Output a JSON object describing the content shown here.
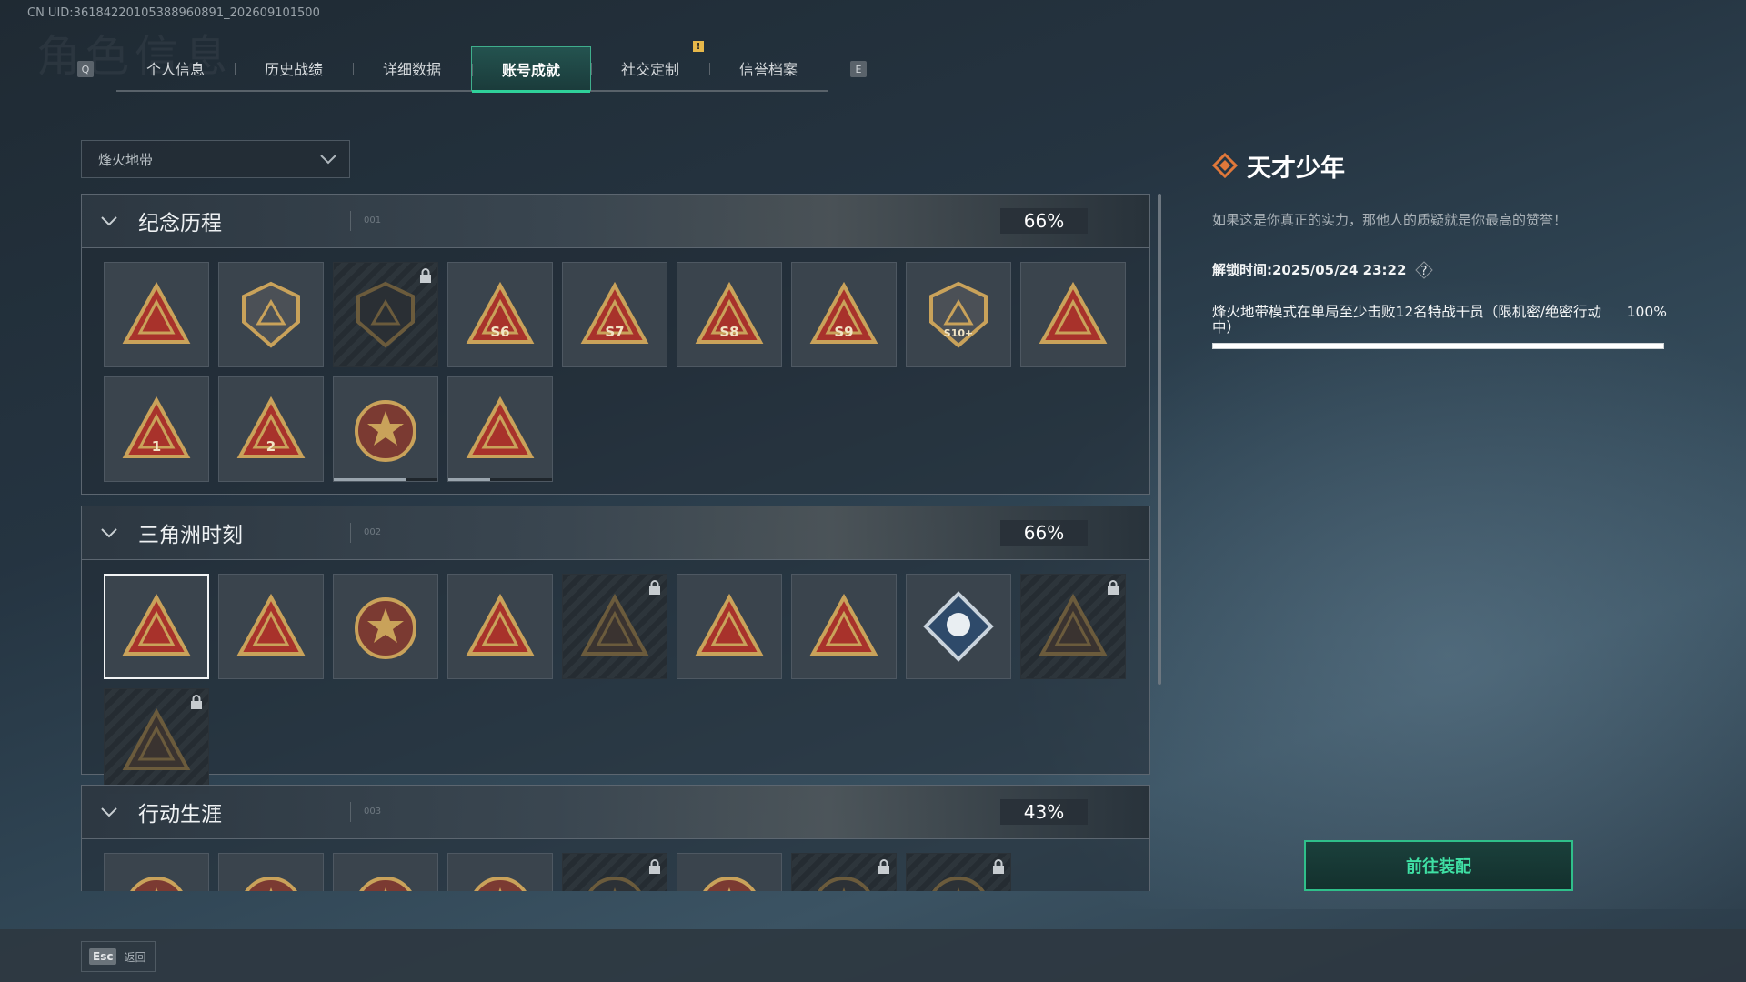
{
  "uid": "CN UID:36184220105388960891_202609101500",
  "tabs": {
    "left_key": "Q",
    "right_key": "E",
    "items": [
      {
        "label": "个人信息"
      },
      {
        "label": "历史战绩"
      },
      {
        "label": "详细数据"
      },
      {
        "label": "账号成就"
      },
      {
        "label": "社交定制"
      },
      {
        "label": "信誉档案"
      }
    ],
    "active_index": 3,
    "notification_badge": "!"
  },
  "mode_dropdown": {
    "selected": "烽火地带"
  },
  "sections": [
    {
      "title": "纪念历程",
      "number": "001",
      "percent": "66%",
      "tiles": [
        {
          "icon": "triangle-emblem-icon",
          "locked": false
        },
        {
          "icon": "helicopter-shield-icon",
          "locked": false
        },
        {
          "icon": "dark-shield-emblem-icon",
          "locked": true
        },
        {
          "icon": "s6-triangle-badge-icon",
          "locked": false,
          "text": "S6"
        },
        {
          "icon": "s7-triangle-badge-icon",
          "locked": false,
          "text": "S7"
        },
        {
          "icon": "s8-triangle-badge-icon",
          "locked": false,
          "text": "S8"
        },
        {
          "icon": "s9-triangle-badge-icon",
          "locked": false,
          "text": "S9"
        },
        {
          "icon": "s10-emblem-icon",
          "locked": false,
          "text": "S10+"
        },
        {
          "icon": "bird-triangle-badge-icon",
          "locked": false
        },
        {
          "icon": "number-1-triangle-icon",
          "locked": false,
          "text": "1"
        },
        {
          "icon": "number-2-triangle-icon",
          "locked": false,
          "text": "2"
        },
        {
          "icon": "delta-force-round-badge-icon",
          "locked": false,
          "progress": 0.7
        },
        {
          "icon": "delta-force-2026-badge-icon",
          "locked": false,
          "progress": 0.4
        }
      ]
    },
    {
      "title": "三角洲时刻",
      "number": "002",
      "percent": "66%",
      "tiles": [
        {
          "icon": "crate-triangle-badge-icon",
          "locked": false,
          "selected": true
        },
        {
          "icon": "kneeling-soldier-badge-icon",
          "locked": false
        },
        {
          "icon": "sheriff-star-badge-icon",
          "locked": false
        },
        {
          "icon": "squad-triangle-badge-icon",
          "locked": false
        },
        {
          "icon": "squad-dark-badge-icon",
          "locked": true
        },
        {
          "icon": "rocket-triangle-badge-icon",
          "locked": false
        },
        {
          "icon": "fish-triangle-badge-icon",
          "locked": false
        },
        {
          "icon": "rose-diamond-badge-icon",
          "locked": false
        },
        {
          "icon": "skull-dark-badge-icon",
          "locked": true
        },
        {
          "icon": "skull-triangle-dark-badge-icon",
          "locked": true
        }
      ]
    },
    {
      "title": "行动生涯",
      "number": "003",
      "percent": "43%",
      "tiles": [
        {
          "icon": "red-star-badge-icon",
          "locked": false
        },
        {
          "icon": "green-star-badge-icon",
          "locked": false
        },
        {
          "icon": "three-star-crest-icon",
          "locked": false
        },
        {
          "icon": "blue-star-crest-icon",
          "locked": false
        },
        {
          "icon": "dark-round-badge-icon",
          "locked": true
        },
        {
          "icon": "round-badge-icon",
          "locked": false
        },
        {
          "icon": "dark-round-badge-icon",
          "locked": true
        },
        {
          "icon": "dark-round-badge-icon",
          "locked": true
        }
      ]
    }
  ],
  "detail": {
    "title": "天才少年",
    "description": "如果这是你真正的实力，那他人的质疑就是你最高的赞誉！",
    "unlock_label": "解锁时间: ",
    "unlock_time": "2025/05/24 23:22",
    "task_text": "烽火地带模式在单局至少击败12名特战干员（限机密/绝密行动",
    "task_text_end": "中）",
    "task_percent": "100%",
    "task_progress": 1.0
  },
  "actions": {
    "go_equip": "前往装配"
  },
  "footer": {
    "esc_key": "Esc",
    "esc_label": "返回"
  },
  "colors": {
    "accent": "#2fd19a",
    "badge_red": "#a8322b",
    "badge_gold": "#c9a25a"
  }
}
